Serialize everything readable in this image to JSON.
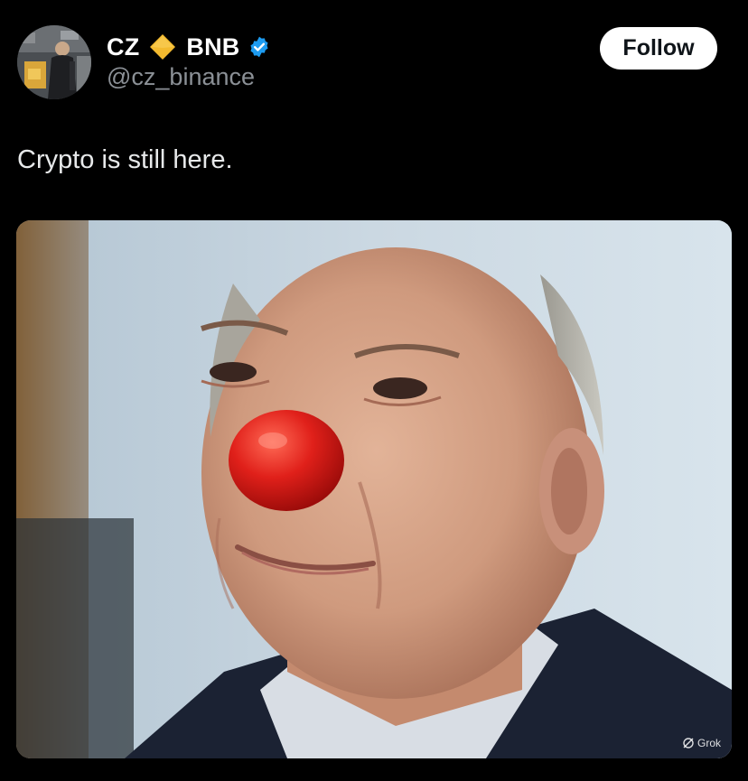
{
  "author": {
    "name_part1": "CZ",
    "name_part2": "BNB",
    "handle": "@cz_binance",
    "diamond_icon": "bnb-diamond-icon",
    "verified_icon": "verified-badge-icon",
    "colors": {
      "diamond": "#f3ba2f",
      "verified": "#1d9bf0"
    }
  },
  "actions": {
    "follow_label": "Follow"
  },
  "tweet": {
    "text": "Crypto is still here."
  },
  "media": {
    "watermark_text": "Grok",
    "watermark_icon": "grok-logo-icon"
  }
}
